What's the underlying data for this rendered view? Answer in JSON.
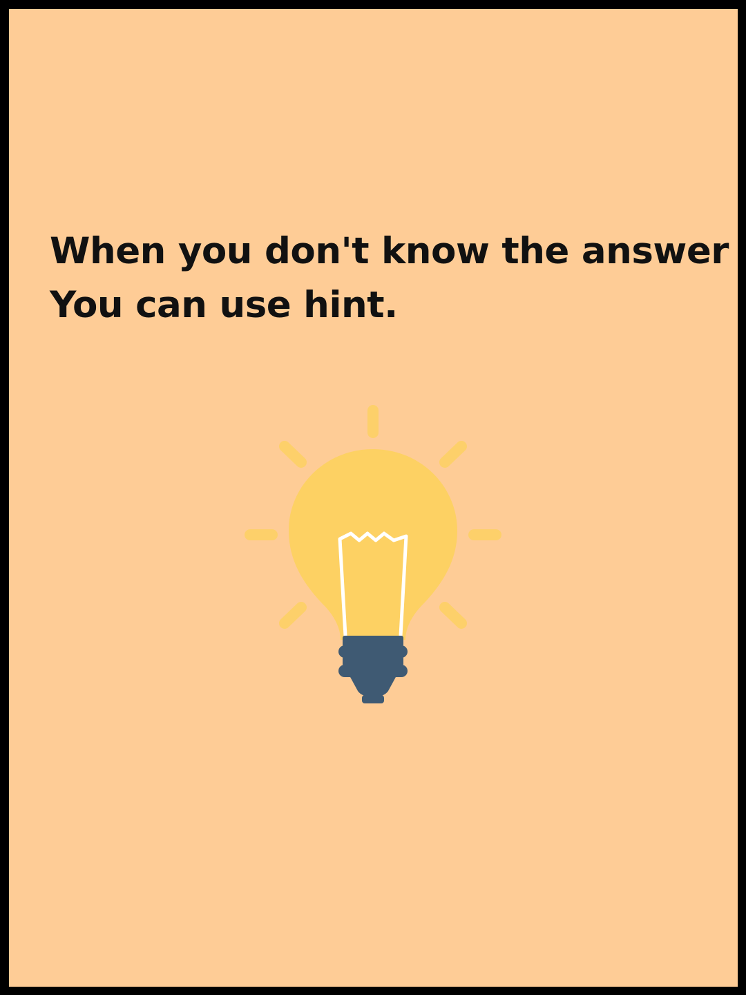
{
  "tutorial": {
    "line1": "When you don't know the answer",
    "line2": "You can use hint."
  },
  "illustration": {
    "icon": "lightbulb-icon"
  },
  "colors": {
    "background": "#FECC96",
    "border": "#000000",
    "text": "#111111",
    "bulb_glass": "#FDD163",
    "bulb_rays": "#FDD163",
    "bulb_base": "#3F5A73",
    "filament": "#FFFFFF"
  }
}
